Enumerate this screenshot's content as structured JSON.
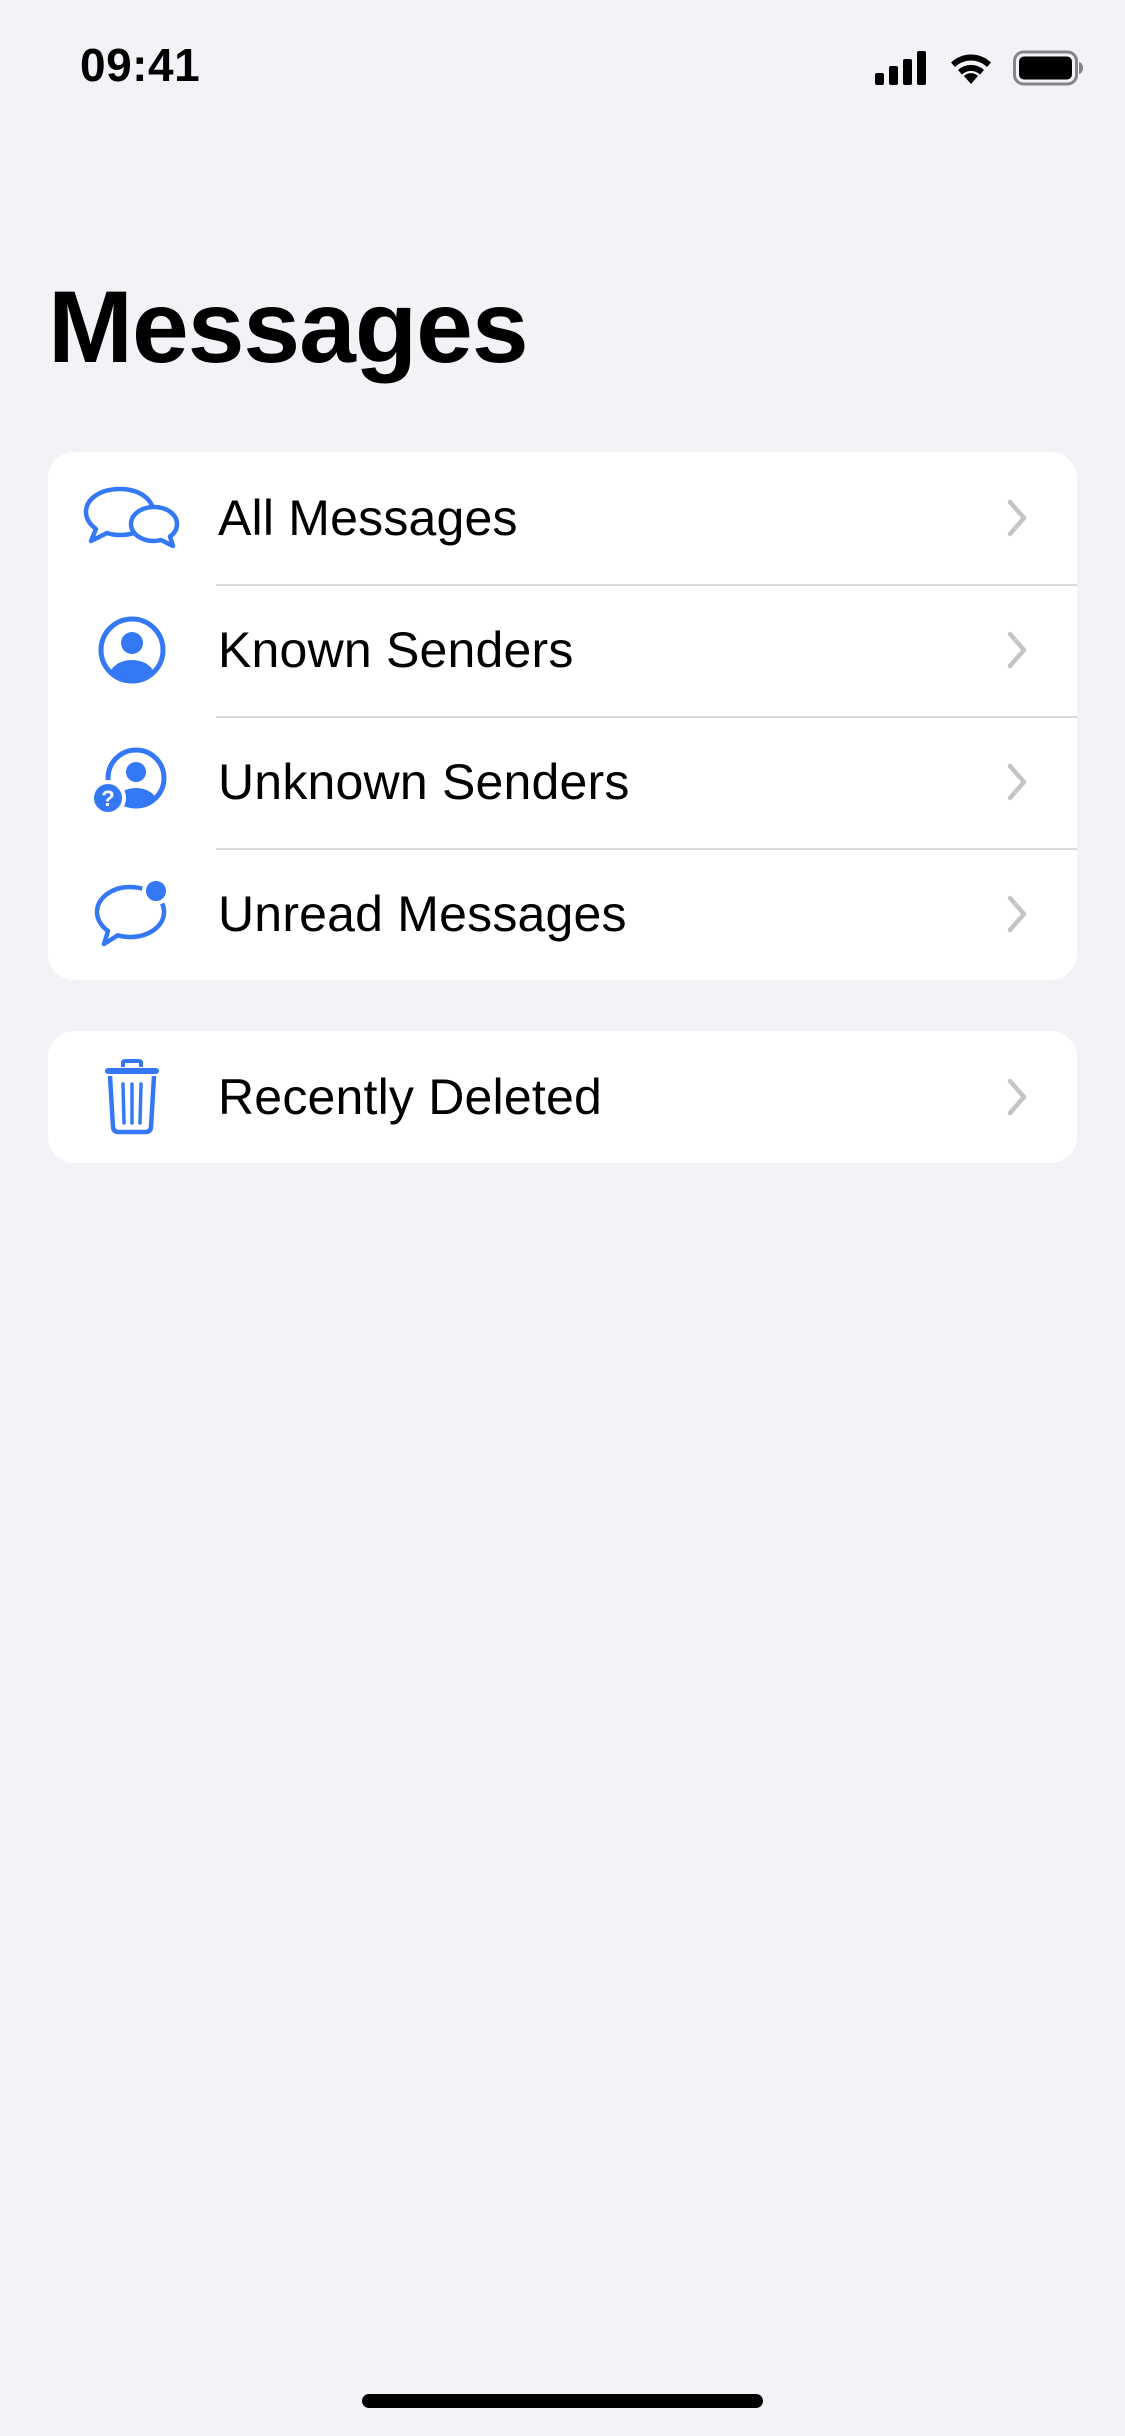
{
  "status_bar": {
    "time": "09:41",
    "icons": [
      "cellular-signal-icon",
      "wifi-icon",
      "battery-icon"
    ]
  },
  "title": "Messages",
  "colors": {
    "background": "#F2F2F7",
    "accent": "#3478F6",
    "chevron": "#C4C4C7",
    "divider": "#D9D9DE"
  },
  "filters": [
    {
      "label": "All Messages",
      "icon": "two-chat-bubbles-icon"
    },
    {
      "label": "Known Senders",
      "icon": "person-circle-icon"
    },
    {
      "label": "Unknown Senders",
      "icon": "person-question-icon"
    },
    {
      "label": "Unread Messages",
      "icon": "chat-bubble-badge-icon"
    }
  ],
  "deleted": {
    "label": "Recently Deleted",
    "icon": "trash-icon"
  }
}
